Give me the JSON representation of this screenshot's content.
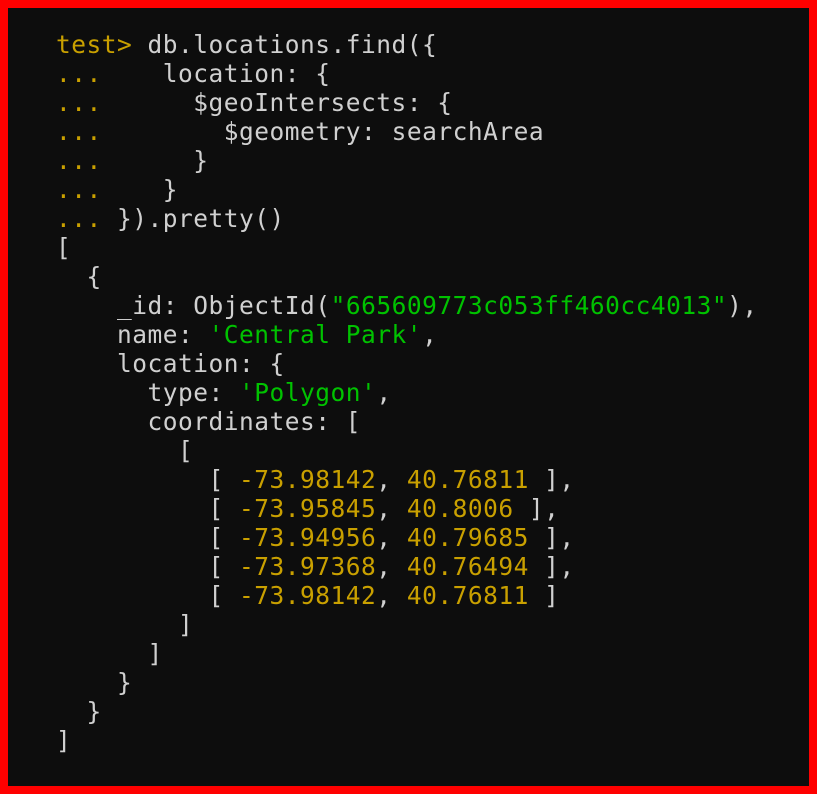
{
  "query": {
    "prompt": "test>",
    "cont": "...",
    "line1": "db.locations.find({",
    "line2": "location: {",
    "line3": "$geoIntersects: {",
    "line4_a": "$geometry:",
    "line4_b": "searchArea",
    "line5": "}",
    "line6": "}",
    "line7": "}).pretty()"
  },
  "result": {
    "open_arr": "[",
    "open_obj": "{",
    "id_key": "_id:",
    "objectid_label": "ObjectId",
    "objectid_open": "(",
    "objectid_value": "\"665609773c053ff460cc4013\"",
    "objectid_close": ")",
    "comma": ",",
    "name_key": "name:",
    "name_value": "'Central Park'",
    "location_key": "location:",
    "obj_open": "{",
    "type_key": "type:",
    "type_value": "'Polygon'",
    "coordinates_key": "coordinates:",
    "arr_open": "[",
    "coords": [
      {
        "a": "-73.98142",
        "b": "40.76811"
      },
      {
        "a": "-73.95845",
        "b": "40.8006"
      },
      {
        "a": "-73.94956",
        "b": "40.79685"
      },
      {
        "a": "-73.97368",
        "b": "40.76494"
      },
      {
        "a": "-73.98142",
        "b": "40.76811"
      }
    ],
    "arr_close": "]",
    "obj_close": "}",
    "close_arr": "]"
  }
}
